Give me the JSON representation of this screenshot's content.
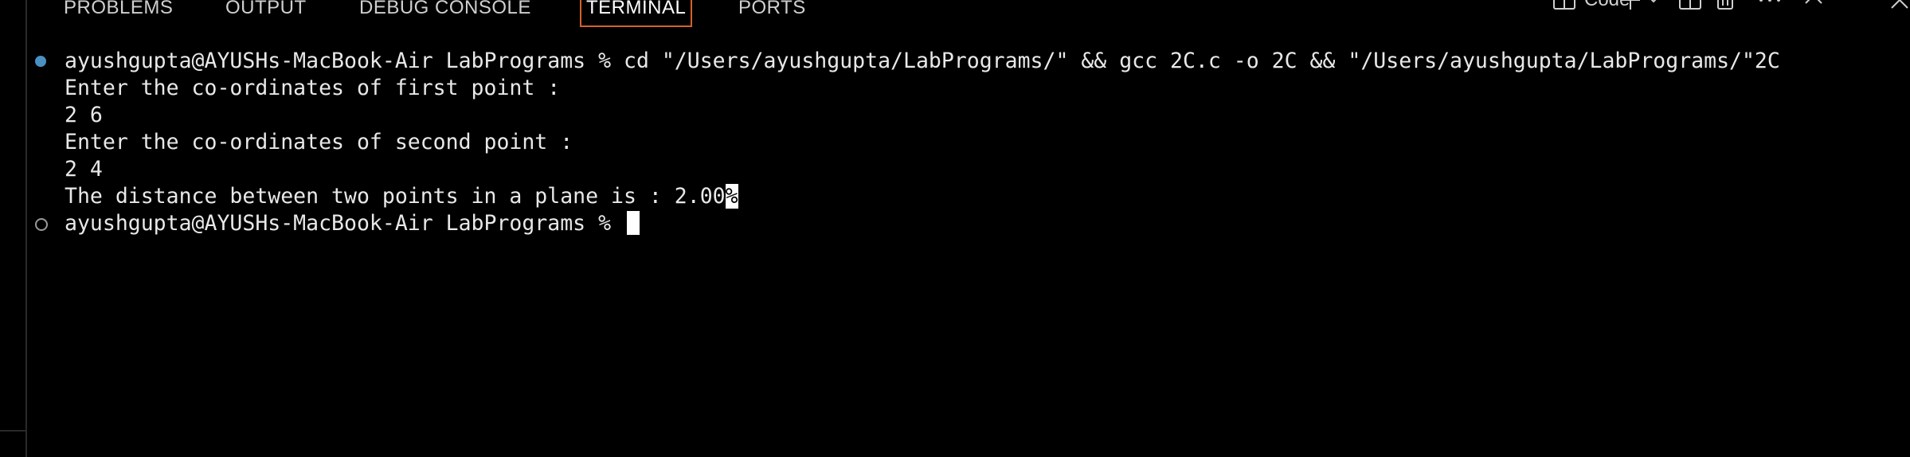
{
  "panel": {
    "tabs": [
      {
        "label": "PROBLEMS"
      },
      {
        "label": "OUTPUT"
      },
      {
        "label": "DEBUG CONSOLE"
      },
      {
        "label": "TERMINAL"
      },
      {
        "label": "PORTS"
      }
    ],
    "active_tab": "TERMINAL",
    "actions": {
      "code_label": "Code",
      "icons": [
        "split-terminal-icon",
        "plus-icon",
        "chevron-down-icon",
        "split-icon",
        "trash-icon",
        "more-icon",
        "chevron-up-icon",
        "close-icon"
      ]
    }
  },
  "terminal": {
    "lines": [
      "ayushgupta@AYUSHs-MacBook-Air LabPrograms % cd \"/Users/ayushgupta/LabPrograms/\" && gcc 2C.c -o 2C && \"/Users/ayushgupta/LabPrograms/\"2C",
      "Enter the co-ordinates of first point :",
      "2 6",
      "Enter the co-ordinates of second point :",
      "2 4",
      "The distance between two points in a plane is : 2.00",
      "ayushgupta@AYUSHs-MacBook-Air LabPrograms % "
    ],
    "eol_mark": "%"
  },
  "colors": {
    "background": "#000000",
    "active_tab_border": "#d4622a",
    "command_decoration": "#4a90c2",
    "text": "#e8e8e8"
  }
}
